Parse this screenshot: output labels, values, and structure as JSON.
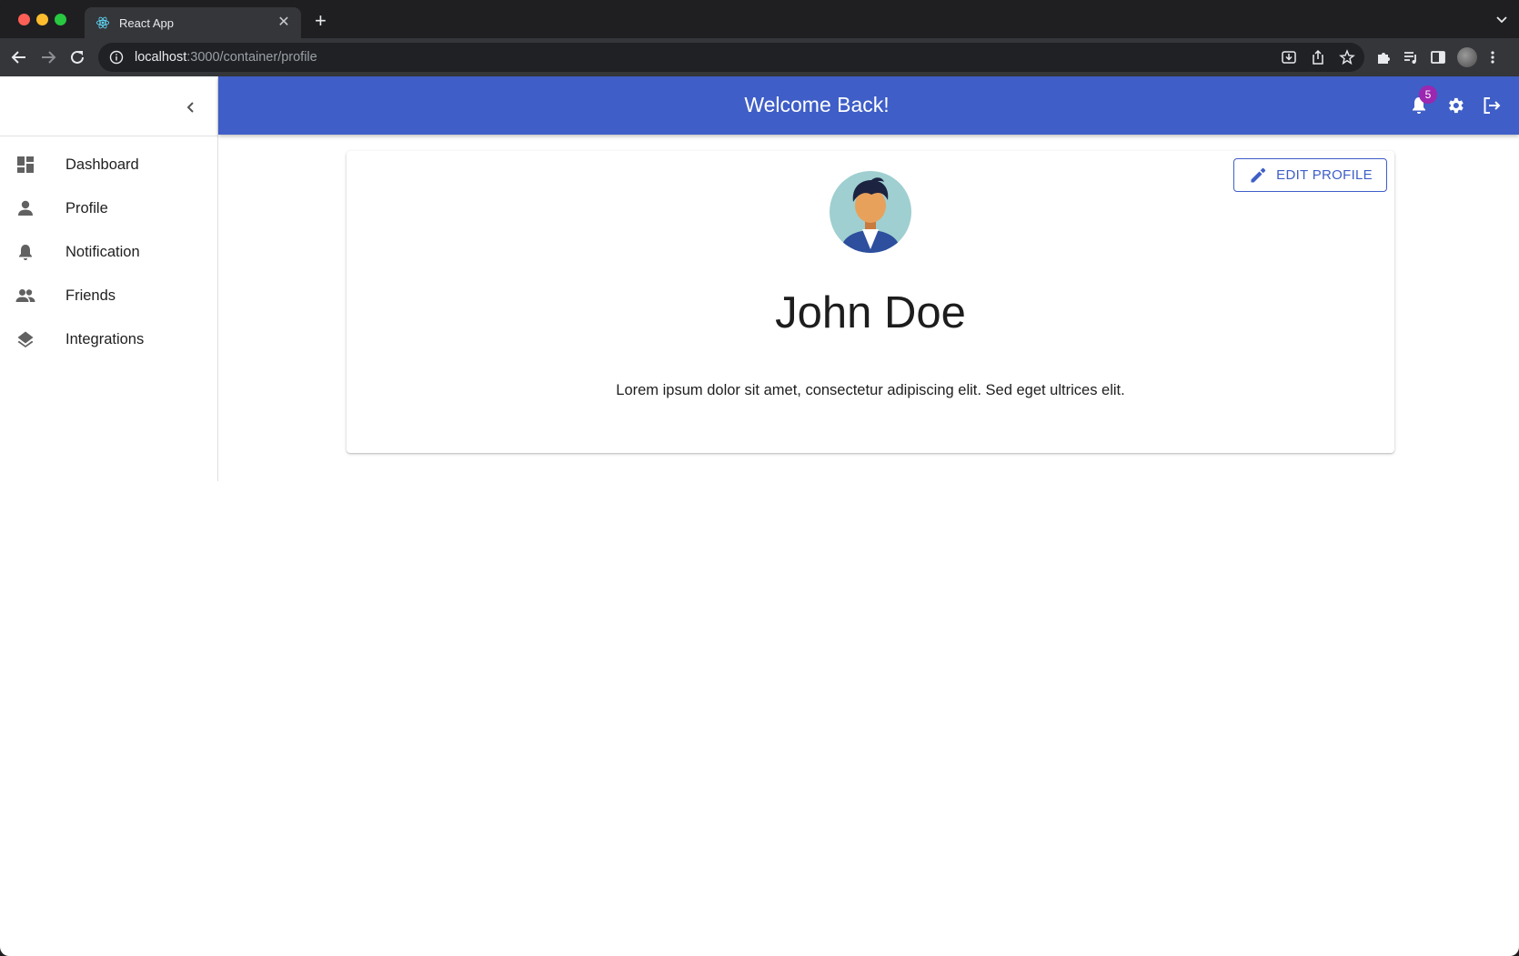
{
  "browser": {
    "tab_title": "React App",
    "tab_close_glyph": "✕",
    "new_tab_glyph": "+",
    "url_host": "localhost",
    "url_path": ":3000/container/profile"
  },
  "sidebar": {
    "items": [
      {
        "label": "Dashboard",
        "icon": "dashboard-icon"
      },
      {
        "label": "Profile",
        "icon": "person-icon"
      },
      {
        "label": "Notification",
        "icon": "bell-icon"
      },
      {
        "label": "Friends",
        "icon": "people-icon"
      },
      {
        "label": "Integrations",
        "icon": "layers-icon"
      }
    ]
  },
  "appbar": {
    "title": "Welcome Back!",
    "notification_count": "5",
    "color": "#3f5ec7"
  },
  "profile": {
    "edit_label": "EDIT PROFILE",
    "name": "John Doe",
    "bio": "Lorem ipsum dolor sit amet, consectetur adipiscing elit. Sed eget ultrices elit."
  },
  "colors": {
    "primary": "#3f5ec7",
    "badge": "#9c27b0"
  }
}
